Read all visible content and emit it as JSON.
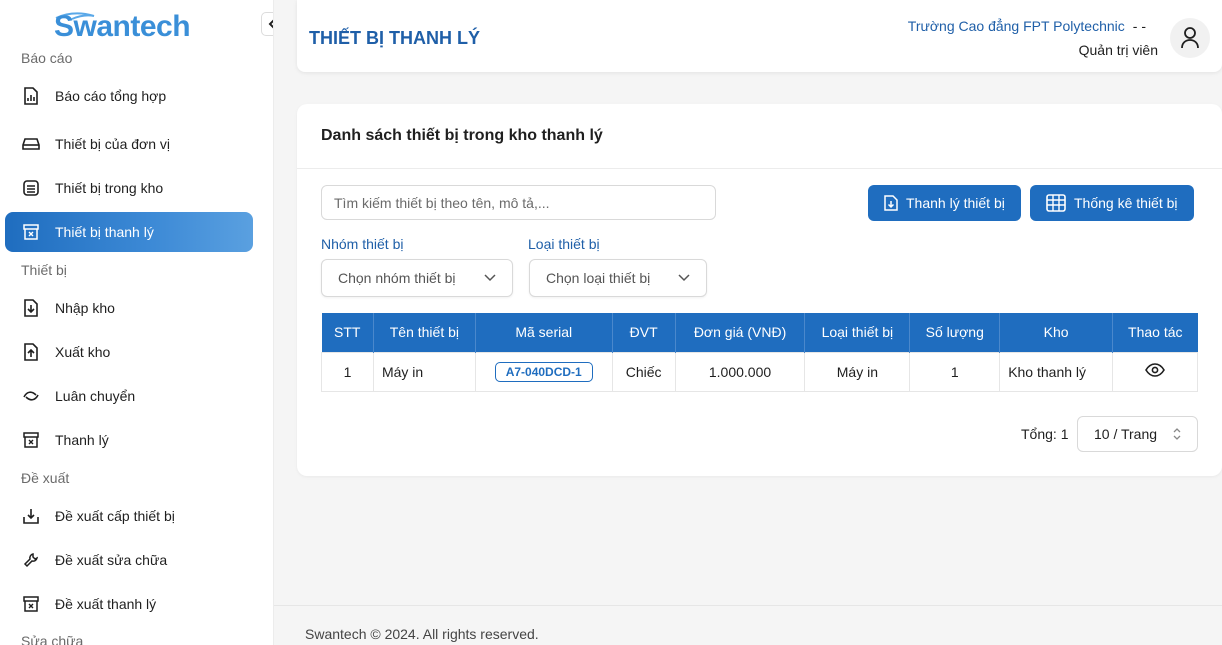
{
  "brand": {
    "logo_text": "Swantech"
  },
  "sidebar": {
    "sections": [
      {
        "label": "Báo cáo"
      },
      {
        "label": "Thiết bị"
      },
      {
        "label": "Đề xuất"
      },
      {
        "label": "Sửa chữa"
      }
    ],
    "items": [
      {
        "label": "Báo cáo tổng hợp",
        "icon": "report-icon"
      },
      {
        "label": "Thiết bị của đơn vị",
        "icon": "drive-icon"
      },
      {
        "label": "Thiết bị trong kho",
        "icon": "database-icon"
      },
      {
        "label": "Thiết bị thanh lý",
        "icon": "archive-x-icon",
        "active": true
      },
      {
        "label": "Nhập kho",
        "icon": "file-import-icon"
      },
      {
        "label": "Xuất kho",
        "icon": "file-export-icon"
      },
      {
        "label": "Luân chuyển",
        "icon": "transfer-icon"
      },
      {
        "label": "Thanh lý",
        "icon": "archive-x-icon"
      },
      {
        "label": "Đề xuất cấp thiết bị",
        "icon": "download-box-icon"
      },
      {
        "label": "Đề xuất sửa chữa",
        "icon": "wrench-icon"
      },
      {
        "label": "Đề xuất thanh lý",
        "icon": "archive-x-icon"
      }
    ]
  },
  "header": {
    "title": "THIẾT BỊ THANH LÝ",
    "school": "Trường Cao đẳng FPT Polytechnic",
    "school_suffix": "-   -",
    "role": "Quản trị viên"
  },
  "card": {
    "title": "Danh sách thiết bị trong kho thanh lý",
    "search_placeholder": "Tìm kiếm thiết bị theo tên, mô tả,...",
    "liquidate_button": "Thanh lý thiết bị",
    "stats_button": "Thống kê thiết bị",
    "group_label": "Nhóm thiết bị",
    "group_placeholder": "Chọn nhóm thiết bị",
    "type_label": "Loại thiết bị",
    "type_placeholder": "Chọn loại thiết bị"
  },
  "table": {
    "columns": [
      "STT",
      "Tên thiết bị",
      "Mã serial",
      "ĐVT",
      "Đơn giá (VNĐ)",
      "Loại thiết bị",
      "Số lượng",
      "Kho",
      "Thao tác"
    ],
    "rows": [
      {
        "stt": "1",
        "name": "Máy in",
        "serial": "A7-040DCD-1",
        "unit": "Chiếc",
        "price": "1.000.000",
        "type": "Máy in",
        "qty": "1",
        "warehouse": "Kho thanh lý"
      }
    ]
  },
  "pagination": {
    "total": "Tổng: 1",
    "page_size": "10 / Trang"
  },
  "footer": {
    "text": "Swantech © 2024. All rights reserved."
  },
  "colors": {
    "primary": "#1f6dbf",
    "title": "#1f5fa8"
  }
}
